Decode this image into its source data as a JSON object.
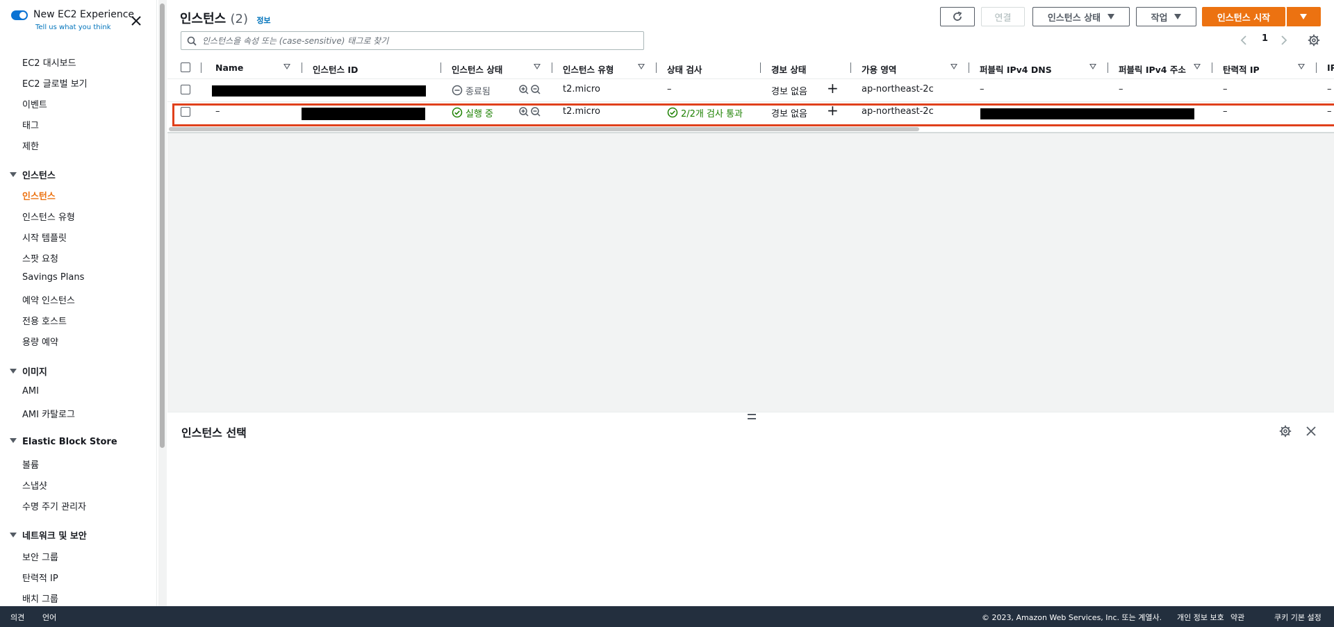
{
  "experience": {
    "title": "New EC2 Experience",
    "link": "Tell us what you think"
  },
  "sidebar": {
    "top_items": [
      "EC2 대시보드",
      "EC2 글로벌 보기",
      "이벤트",
      "태그",
      "제한"
    ],
    "sections": [
      {
        "label": "인스턴스",
        "items": [
          "인스턴스",
          "인스턴스 유형",
          "시작 템플릿",
          "스팟 요청",
          "Savings Plans",
          "예약 인스턴스",
          "전용 호스트",
          "용량 예약"
        ]
      },
      {
        "label": "이미지",
        "items": [
          "AMI",
          "AMI 카탈로그"
        ]
      },
      {
        "label": "Elastic Block Store",
        "items": [
          "볼륨",
          "스냅샷",
          "수명 주기 관리자"
        ]
      },
      {
        "label": "네트워크 및 보안",
        "items": [
          "보안 그룹",
          "탄력적 IP",
          "배치 그룹"
        ]
      }
    ],
    "active_item": "인스턴스"
  },
  "header": {
    "title": "인스턴스",
    "count": "(2)",
    "info": "정보"
  },
  "toolbar": {
    "connect": "연결",
    "instance_state": "인스턴스 상태",
    "actions": "작업",
    "launch": "인스턴스 시작"
  },
  "search": {
    "placeholder": "인스턴스을 속성 또는 (case-sensitive) 태그로 찾기"
  },
  "pagination": {
    "page": "1"
  },
  "table": {
    "columns": [
      "Name",
      "인스턴스 ID",
      "인스턴스 상태",
      "인스턴스 유형",
      "상태 검사",
      "경보 상태",
      "가용 영역",
      "퍼블릭 IPv4 DNS",
      "퍼블릭 IPv4 주소",
      "탄력적 IP",
      "IP"
    ],
    "rows": [
      {
        "name": "",
        "id": "",
        "state": "종료됨",
        "type": "t2.micro",
        "check": "–",
        "alarm": "경보 없음",
        "az": "ap-northeast-2c",
        "dns": "–",
        "ipv4": "–",
        "eip": "–",
        "ip": "–"
      },
      {
        "name": "–",
        "id": "",
        "state": "실행 중",
        "type": "t2.micro",
        "check": "2/2개 검사 통과",
        "alarm": "경보 없음",
        "az": "ap-northeast-2c",
        "dns": "",
        "ipv4": "",
        "eip": "–",
        "ip": "–"
      }
    ]
  },
  "lower_panel": {
    "title": "인스턴스 선택"
  },
  "footer": {
    "feedback": "의견",
    "language": "언어",
    "copyright": "© 2023, Amazon Web Services, Inc. 또는 계열사.",
    "privacy": "개인 정보 보호",
    "terms": "약관",
    "cookies": "쿠키 기본 설정"
  },
  "colors": {
    "accent": "#ec7211",
    "link": "#0073bb",
    "success": "#1d8102",
    "highlight": "#e0401b",
    "footer_bg": "#232f3e"
  }
}
